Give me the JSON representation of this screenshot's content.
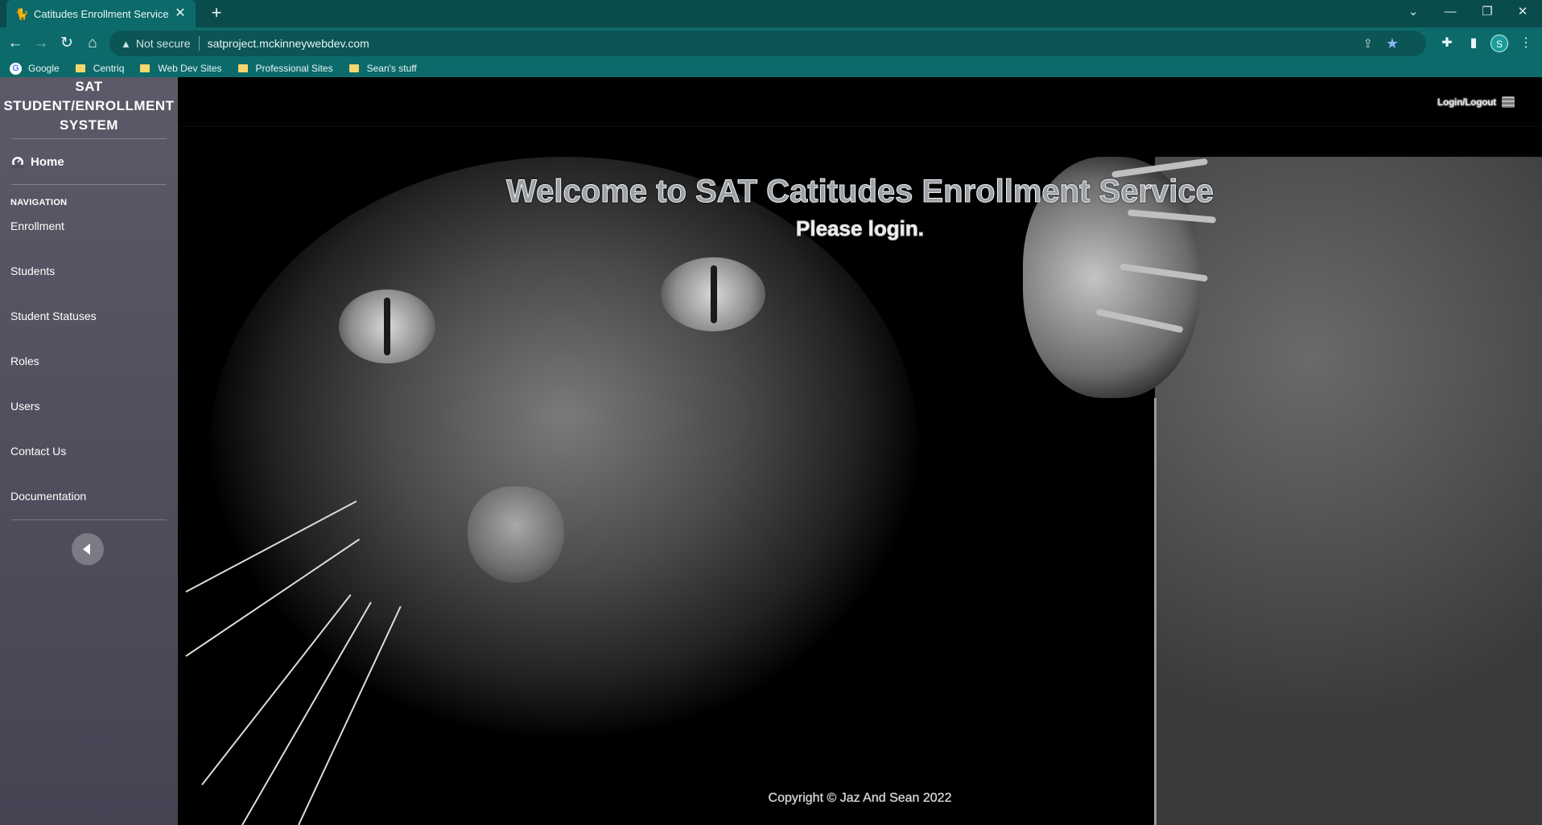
{
  "browser": {
    "tab_title": "Catitudes Enrollment Service",
    "tab_close": "✕",
    "new_tab": "+",
    "url": "satproject.mckinneywebdev.com",
    "security_label": "Not secure",
    "bookmarks": [
      "Google",
      "Centriq",
      "Web Dev Sites",
      "Professional Sites",
      "Sean's stuff"
    ],
    "profile_initial": "S"
  },
  "sidebar": {
    "brand": [
      "SAT",
      "STUDENT/ENROLLMENT",
      "SYSTEM"
    ],
    "home_label": "Home",
    "nav_heading": "NAVIGATION",
    "items": [
      "Enrollment",
      "Students",
      "Student Statuses",
      "Roles",
      "Users",
      "Contact Us",
      "Documentation"
    ]
  },
  "header": {
    "login_label": "Login/Logout"
  },
  "hero": {
    "welcome": "Welcome to SAT Catitudes Enrollment Service",
    "prompt": "Please login."
  },
  "footer": {
    "copyright": "Copyright © Jaz And Sean 2022"
  },
  "colors": {
    "chrome": "#0d6a6a",
    "sidebar": "#4f4f5d"
  }
}
